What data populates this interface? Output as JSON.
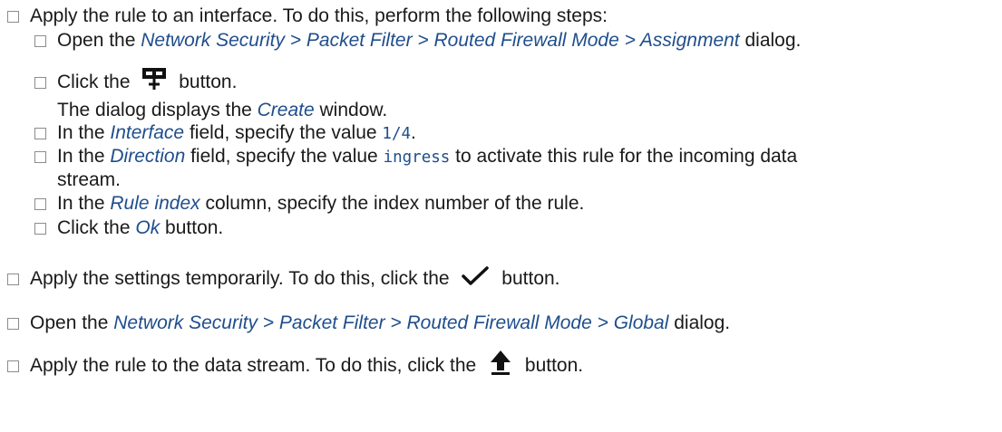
{
  "steps": {
    "s1": {
      "text": "Apply the rule to an interface. To do this, perform the following steps:"
    },
    "s1a": {
      "pre": "Open the ",
      "link": "Network Security > Packet Filter > Routed Firewall Mode > Assignment",
      "post": " dialog."
    },
    "s1b": {
      "pre": "Click the",
      "icon": "add-table-icon",
      "post": "button."
    },
    "s1b_result": {
      "pre": "The dialog displays the ",
      "link": "Create",
      "post": " window."
    },
    "s1c": {
      "pre": "In the ",
      "field": "Interface",
      "mid": " field, specify the value ",
      "value": "1/4",
      "post": "."
    },
    "s1d": {
      "pre": "In the ",
      "field": "Direction",
      "mid": " field, specify the value ",
      "value": "ingress",
      "post": " to activate this rule for the incoming data",
      "line2": "stream."
    },
    "s1e": {
      "pre": "In the ",
      "field": "Rule index",
      "post": " column, specify the index number of the rule."
    },
    "s1f": {
      "pre": "Click the ",
      "field": "Ok",
      "post": " button."
    },
    "s2": {
      "pre": "Apply the settings temporarily. To do this, click the",
      "icon": "checkmark-icon",
      "post": "button."
    },
    "s3": {
      "pre": "Open the ",
      "link": "Network Security > Packet Filter > Routed Firewall Mode > Global",
      "post": " dialog."
    },
    "s4": {
      "pre": "Apply the rule to the data stream. To do this, click the",
      "icon": "upload-arrow-icon",
      "post": "button."
    }
  },
  "colors": {
    "link": "#1f4e8c",
    "text": "#1a1a1a",
    "checkbox": "#8c8c8c"
  }
}
